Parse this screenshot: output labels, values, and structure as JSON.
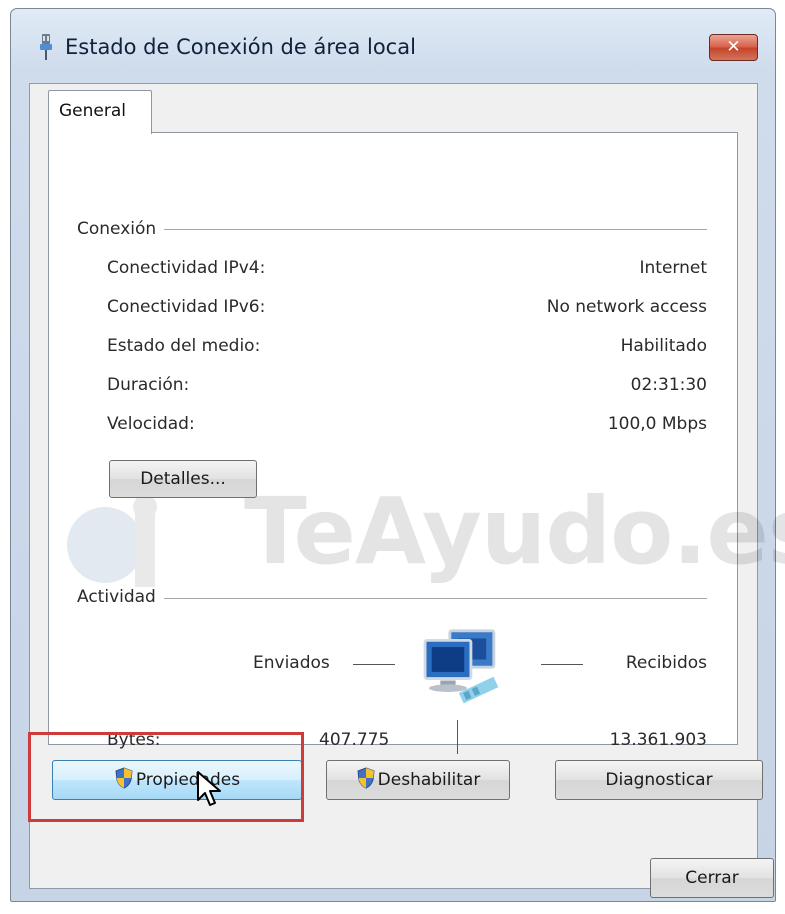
{
  "window": {
    "title": "Estado de Conexión de área local",
    "close_glyph": "✕"
  },
  "tabs": [
    {
      "label": "General",
      "selected": true
    }
  ],
  "connection": {
    "header": "Conexión",
    "rows": [
      {
        "label": "Conectividad IPv4:",
        "value": "Internet"
      },
      {
        "label": "Conectividad IPv6:",
        "value": "No network access"
      },
      {
        "label": "Estado del medio:",
        "value": "Habilitado"
      },
      {
        "label": "Duración:",
        "value": "02:31:30"
      },
      {
        "label": "Velocidad:",
        "value": "100,0 Mbps"
      }
    ],
    "details_button": "Detalles..."
  },
  "activity": {
    "header": "Actividad",
    "sent_label": "Enviados",
    "received_label": "Recibidos",
    "bytes_label": "Bytes:",
    "bytes_sent": "407.775",
    "bytes_received": "13.361.903",
    "icon": "network-computers-icon"
  },
  "buttons": {
    "properties": "Propiedades",
    "disable": "Deshabilitar",
    "diagnose": "Diagnosticar",
    "close": "Cerrar"
  },
  "watermark": "TeAyudo.es",
  "colors": {
    "highlight": "#cf3b3b",
    "close_button": "#c44329",
    "focus_button": "#bee6fd"
  }
}
